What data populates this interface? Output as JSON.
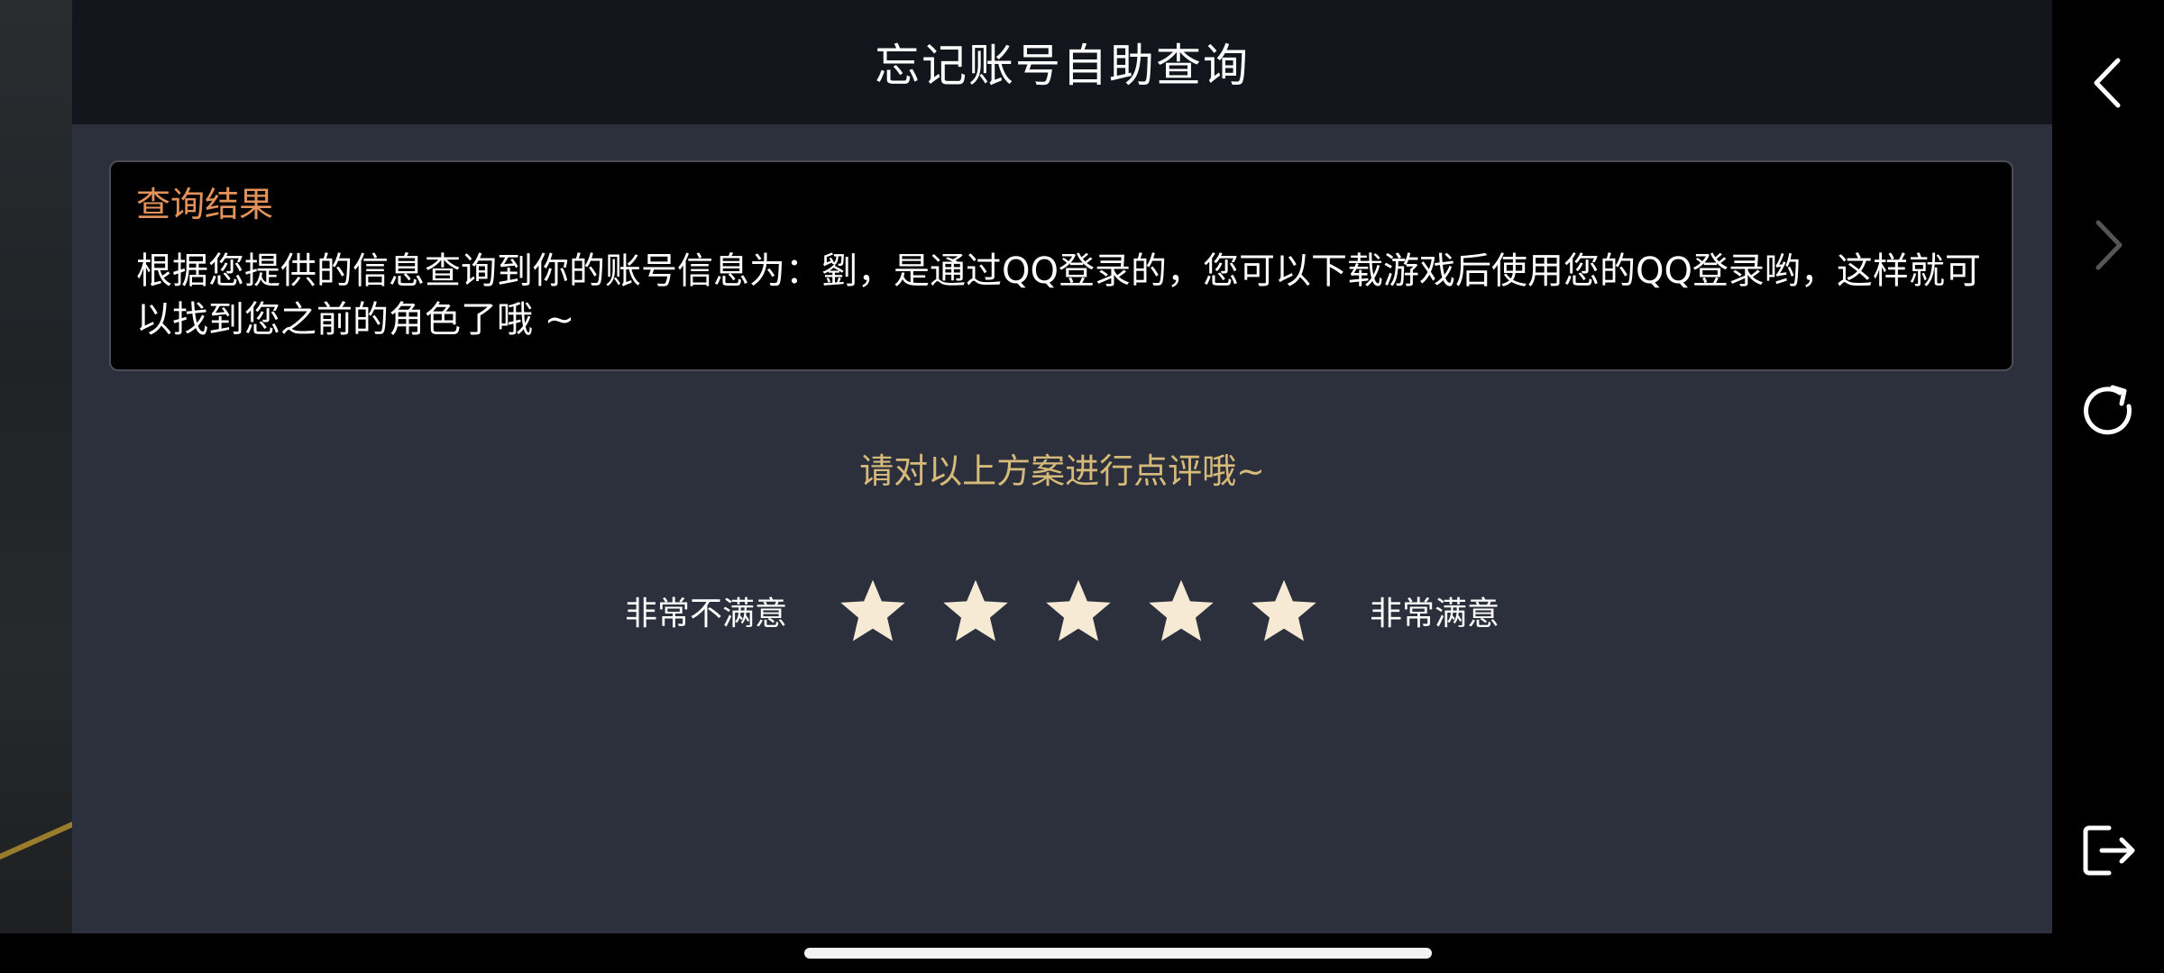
{
  "header": {
    "title": "忘记账号自助查询"
  },
  "result": {
    "title": "查询结果",
    "text": "根据您提供的信息查询到你的账号信息为：劉，是通过QQ登录的，您可以下载游戏后使用您的QQ登录哟，这样就可以找到您之前的角色了哦 ~"
  },
  "rating": {
    "prompt": "请对以上方案进行点评哦~",
    "low_label": "非常不满意",
    "high_label": "非常满意",
    "star_count": 5,
    "star_color": "#f7ead5"
  },
  "toolbar": {
    "items": [
      {
        "icon": "chevron-left-icon",
        "enabled": true
      },
      {
        "icon": "chevron-right-icon",
        "enabled": false
      },
      {
        "icon": "refresh-icon",
        "enabled": true
      },
      {
        "icon": "exit-icon",
        "enabled": true
      }
    ]
  },
  "colors": {
    "panel_bg": "#2c303d",
    "header_bg": "#13151c",
    "result_title": "#e3935a",
    "prompt": "#d6ba79"
  }
}
